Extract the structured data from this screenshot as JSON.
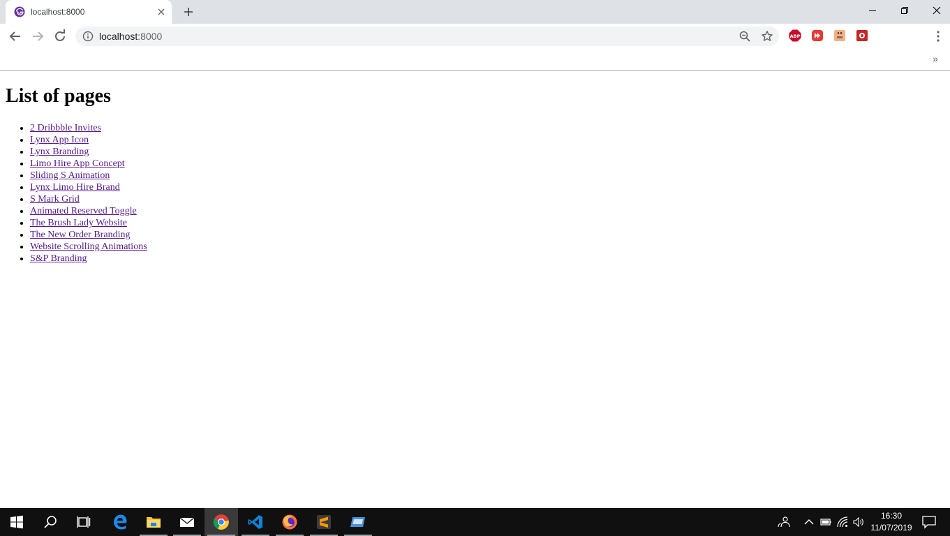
{
  "browser": {
    "tab_title": "localhost:8000",
    "url_host": "localhost",
    "url_port": ":8000",
    "bookmarks_overflow": "»",
    "extensions": [
      "adblock-plus-icon",
      "media-extension-icon",
      "dictionary-extension-icon",
      "web-dev-extension-icon"
    ]
  },
  "page": {
    "heading": "List of pages",
    "links": [
      "2 Dribbble Invites",
      "Lynx App Icon",
      "Lynx Branding",
      "Limo Hire App Concept",
      "Sliding S Animation",
      "Lynx Limo Hire Brand",
      "S Mark Grid",
      "Animated Reserved Toggle",
      "The Brush Lady Website",
      "The New Order Branding",
      "Website Scrolling Animations",
      "S&P Branding"
    ]
  },
  "taskbar": {
    "time": "16:30",
    "date": "11/07/2019",
    "apps": [
      "start-icon",
      "search-icon",
      "task-view-icon",
      "edge-icon",
      "file-explorer-icon",
      "mail-icon",
      "chrome-icon",
      "vscode-icon",
      "firefox-icon",
      "sublime-icon",
      "remote-desktop-icon"
    ]
  },
  "colors": {
    "tabstrip": "#dee1e6",
    "omnibox": "#f1f3f4",
    "visited_link": "#551a8b",
    "taskbar": "#101010"
  }
}
